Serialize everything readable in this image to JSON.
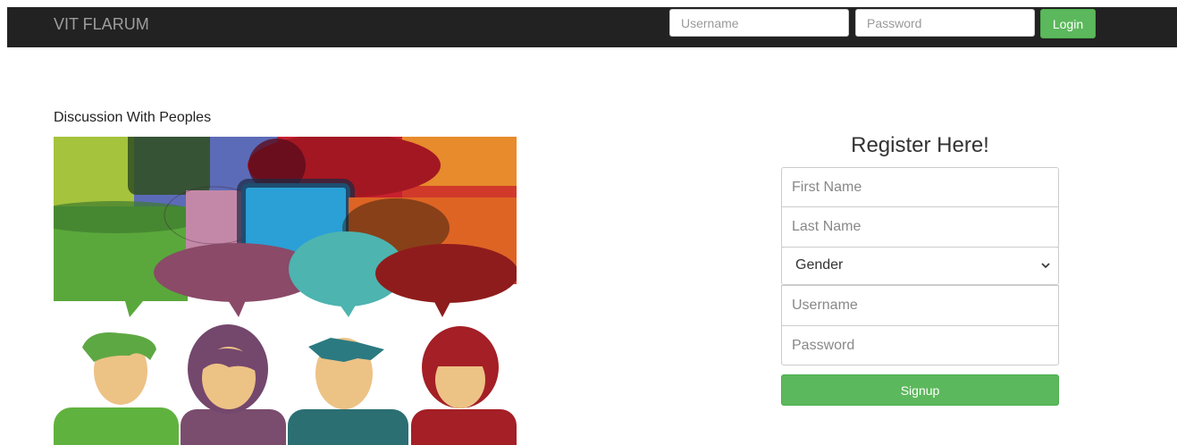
{
  "navbar": {
    "brand": "VIT FLARUM",
    "username_placeholder": "Username",
    "password_placeholder": "Password",
    "login_label": "Login"
  },
  "left": {
    "title": "Discussion With Peoples"
  },
  "register": {
    "heading": "Register Here!",
    "first_name_placeholder": "First Name",
    "last_name_placeholder": "Last Name",
    "gender_selected": "Gender",
    "username_placeholder": "Username",
    "password_placeholder": "Password",
    "signup_label": "Signup"
  },
  "colors": {
    "navbar_bg": "#222222",
    "brand_text": "#9d9d9d",
    "accent_green": "#5cb85c"
  }
}
